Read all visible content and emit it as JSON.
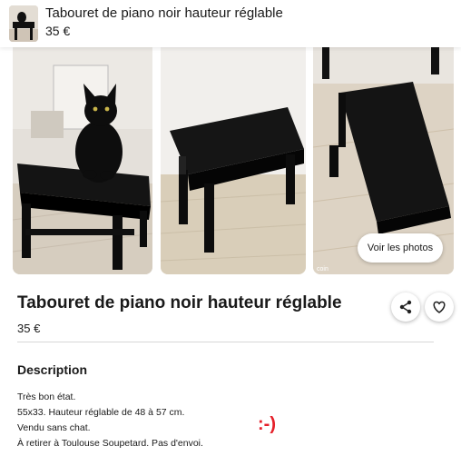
{
  "header": {
    "title": "Tabouret de piano noir hauteur réglable",
    "price": "35 €"
  },
  "gallery": {
    "view_photos_label": "Voir les photos"
  },
  "listing": {
    "title": "Tabouret de piano noir hauteur réglable",
    "price": "35 €"
  },
  "description": {
    "heading": "Description",
    "lines": [
      "Très bon état.",
      "55x33. Hauteur réglable de 48 à 57 cm.",
      "Vendu sans chat.",
      "À retirer à Toulouse Soupetard. Pas d'envoi."
    ]
  },
  "annotation": ":-)",
  "colors": {
    "annotation": "#e5202a",
    "stool": "#111111",
    "floor": "#d8cfc3"
  },
  "icons": [
    "share-icon",
    "heart-icon"
  ]
}
